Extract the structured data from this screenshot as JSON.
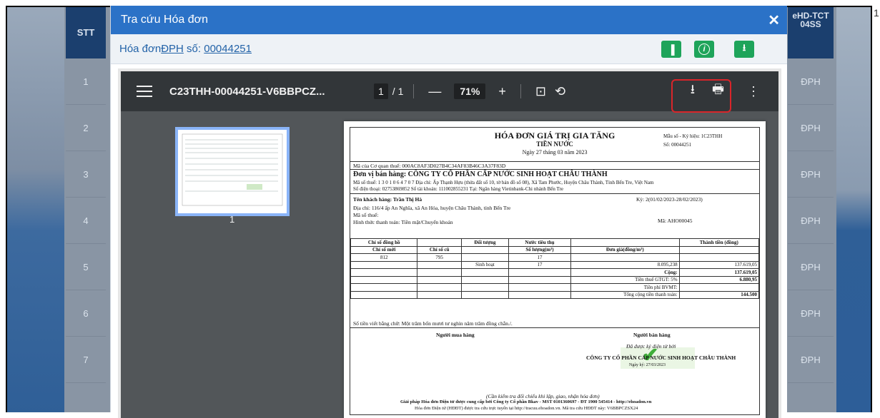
{
  "background": {
    "stt_header": "STT",
    "rows": [
      "1",
      "2",
      "3",
      "4",
      "5",
      "6",
      "7"
    ],
    "right_header": "eHD-TCT 04SS",
    "right_rows": [
      "ĐPH",
      "ĐPH",
      "ĐPH",
      "ĐPH",
      "ĐPH",
      "ĐPH",
      "ĐPH"
    ],
    "corner_number": "1"
  },
  "modal": {
    "title": "Tra cứu Hóa đơn",
    "subtitle_prefix": "Hóa đơn ",
    "subtitle_type": "ĐPH",
    "subtitle_mid": " số: ",
    "invoice_number": "00044251"
  },
  "viewer": {
    "file_name": "C23THH-00044251-V6BBPCZ...",
    "page_current": "1",
    "page_total": "/ 1",
    "zoom": "71%",
    "thumb_page": "1"
  },
  "invoice": {
    "title": "HÓA ĐƠN GIÁ TRỊ GIA TĂNG",
    "subtitle": "TIỀN NƯỚC",
    "date": "Ngày 27 tháng 03 năm 2023",
    "mau_so": "Mẫu số - Ký hiệu: 1C23THH",
    "so": "Số: 00044251",
    "ma_cqt": "Mã của Cơ quan thuế: 000AC8AF3D027B4C34AF83B46C3A37F83D",
    "seller": "Đơn vị bán hàng: CÔNG TY CỔ PHẦN CẤP NƯỚC SINH HOẠT CHÂU THÀNH",
    "seller_tax": "Mã số thuế: 1 3 0 1 0 6 4 7 0 7     Địa chỉ: Ấp Thạnh Hựu (thửa đất số 10, tờ bản đồ số 08), Xã Tam Phước, Huyện Châu Thành, Tỉnh Bến Tre, Việt Nam",
    "seller_phone": "Số điện thoại: 02753869852        Số tài khoản: 111002855231        Tại: Ngân hàng Vietinbank-Chi nhánh Bến Tre",
    "buyer": "Tên khách hàng: Trần Thị Hà",
    "period": "Kỳ: 2(01/02/2023-28/02/2023)",
    "buyer_addr": "Địa chỉ: 116/4 ấp An Nghĩa, xã An Hóa, huyện Châu Thành, tỉnh Bến Tre",
    "buyer_tax": "Mã số thuế:",
    "payment": "Hình thức thanh toán: Tiền mặt/Chuyển khoản",
    "customer_code": "Mã: AHO00045",
    "grid": [
      [
        "Chỉ số đồng hồ",
        "",
        "Đối tượng",
        "Nước tiêu thụ",
        "",
        "Thành tiền (đồng)"
      ],
      [
        "Chỉ số mới",
        "Chỉ số cũ",
        "",
        "Số lượng(m³)",
        "Đơn giá(đồng/m³)",
        ""
      ],
      [
        "812",
        "795",
        "",
        "17",
        "",
        ""
      ],
      [
        "",
        "",
        "Sinh hoạt",
        "17",
        "8.095,238",
        "137.619,05"
      ],
      [
        "",
        "",
        "",
        "",
        "Cộng:",
        "137.619,05"
      ],
      [
        "",
        "",
        "",
        "",
        "Tiền thuế GTGT: 5%",
        "6.880,95"
      ],
      [
        "",
        "",
        "",
        "",
        "Tiền phí BVMT:",
        ""
      ],
      [
        "",
        "",
        "",
        "",
        "Tổng cộng tiền thanh toán:",
        "144.500"
      ]
    ],
    "in_words": "Số tiền viết bằng chữ: Một trăm bốn mươi tư nghìn năm trăm đồng chẵn./.",
    "buyer_sign": "Người mua hàng",
    "seller_sign": "Người bán hàng",
    "signed_by": "Đã được ký điện tử bởi",
    "signed_company": "CÔNG TY CỔ PHẦN CẤP NƯỚC SINH HOẠT CHÂU THÀNH",
    "signed_date": "Ngày ký: 27/03/2023",
    "footer1": "(Cần kiểm tra đối chiếu khi lập, giao, nhận hóa đơn)",
    "footer2": "Giải pháp Hóa đơn Điện tử được cung cấp bởi Công ty Cổ phần Bkav - MST 0101360697 - ĐT 1900 545414 - http://ehoadon.vn",
    "footer3": "Hóa đơn Điện tử (HĐĐT) được tra cứu trực tuyến tại http://tracuu.ehoadon.vn. Mã tra cứu HĐĐT này: V6BBPCZSX24"
  },
  "colors": {
    "header_blue": "#2b72c7",
    "button_green": "#1ea45a",
    "highlight_red": "#d9252a"
  }
}
